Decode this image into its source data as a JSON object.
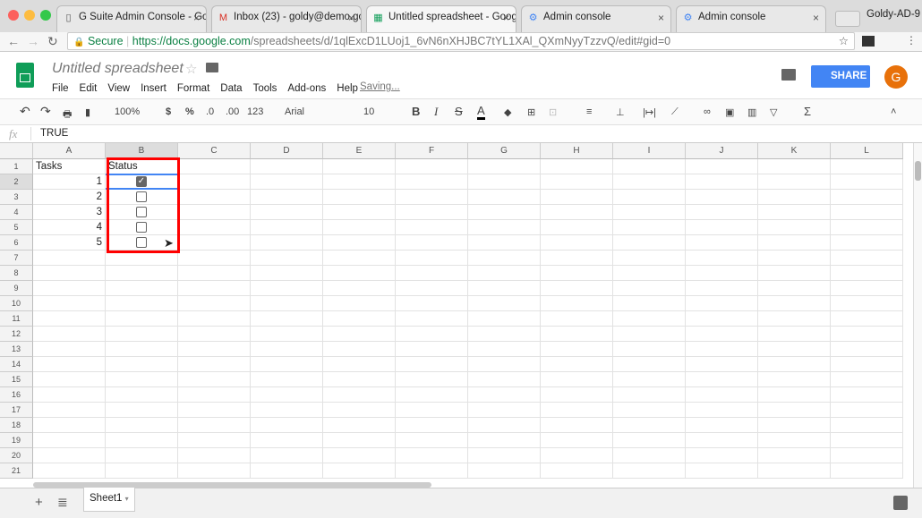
{
  "browser": {
    "tabs": [
      {
        "title": "G Suite Admin Console - Goo",
        "icon": "doc-icon"
      },
      {
        "title": "Inbox (23) - goldy@demo.go",
        "icon": "gmail-icon"
      },
      {
        "title": "Untitled spreadsheet - Goog",
        "icon": "sheets-icon",
        "active": true
      },
      {
        "title": "Admin console",
        "icon": "admin-icon"
      },
      {
        "title": "Admin console",
        "icon": "admin-icon"
      }
    ],
    "profile": "Goldy-AD-9",
    "secure": "Secure",
    "url_host": "https://docs.google.com",
    "url_path": "/spreadsheets/d/1qlExcD1LUoj1_6vN6nXHJBC7tYL1XAl_QXmNyyTzzvQ/edit#gid=0"
  },
  "app": {
    "title": "Untitled spreadsheet",
    "menu": [
      "File",
      "Edit",
      "View",
      "Insert",
      "Format",
      "Data",
      "Tools",
      "Add-ons",
      "Help"
    ],
    "status": "Saving...",
    "share": "SHARE",
    "avatar": "G",
    "accent": "#4285f4",
    "avatar_color": "#e8710a"
  },
  "toolbar": {
    "zoom": "100%",
    "currency": "$",
    "percent": "%",
    "dec_less": ".0",
    "dec_more": ".00",
    "format": "123",
    "font": "Arial",
    "size": "10",
    "bold": "B",
    "italic": "I",
    "strike": "S",
    "color": "A",
    "sum": "Σ"
  },
  "formula": {
    "fx": "fx",
    "value": "TRUE"
  },
  "sheet": {
    "columns": [
      "A",
      "B",
      "C",
      "D",
      "E",
      "F",
      "G",
      "H",
      "I",
      "J",
      "K",
      "L"
    ],
    "row_count": 21,
    "cells": {
      "A1": "Tasks",
      "B1": "Status",
      "A2": "1",
      "A3": "2",
      "A4": "3",
      "A5": "4",
      "A6": "5"
    },
    "checkboxes": [
      true,
      false,
      false,
      false,
      false
    ],
    "selected": "B2",
    "highlight_color": "#ff0000"
  },
  "bottom": {
    "sheet_tab": "Sheet1"
  }
}
